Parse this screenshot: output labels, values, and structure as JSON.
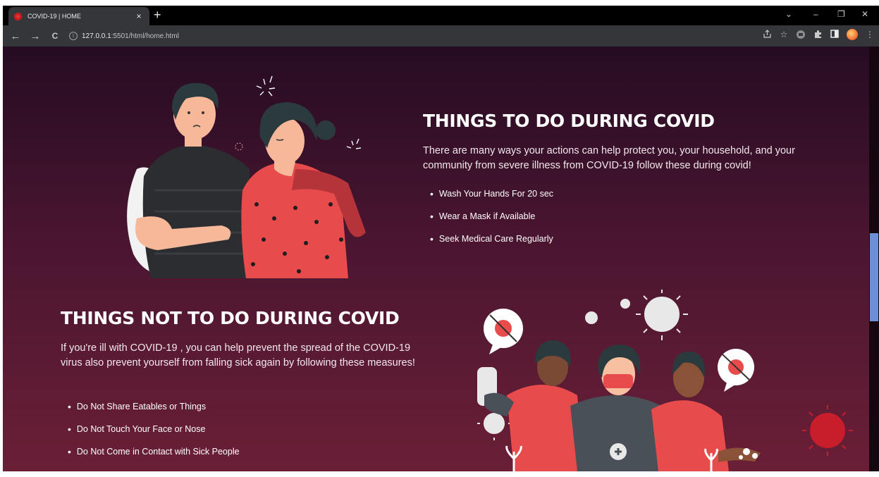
{
  "browser": {
    "tab_title": "COVID-19 | HOME",
    "tab_close": "×",
    "new_tab": "+",
    "url_host": "127.0.0.1",
    "url_rest": ":5501/html/home.html",
    "window_controls": [
      "⌄",
      "–",
      "❐",
      "✕"
    ],
    "nav": [
      "←",
      "→",
      "C"
    ],
    "toolbar_icons": [
      "share-icon",
      "star-icon",
      "extension-box-icon",
      "puzzle-icon",
      "sidebar-icon",
      "profile-icon",
      "menu-icon"
    ]
  },
  "section_do": {
    "title": "THINGS TO DO DURING COVID",
    "desc": "There are many ways your actions can help protect you, your household, and your community from severe illness from COVID-19 follow these during covid!",
    "items": [
      "Wash Your Hands For 20 sec",
      "Wear a Mask if Available",
      "Seek Medical Care Regularly"
    ]
  },
  "section_dont": {
    "title": "THINGS NOT TO DO DURING COVID",
    "desc": "If you're ill with COVID-19 , you can help prevent the spread of the COVID-19 virus also prevent yourself from falling sick again by following these measures!",
    "items": [
      "Do Not Share Eatables or Things",
      "Do Not Touch Your Face or Nose",
      "Do Not Come in Contact with Sick People"
    ]
  },
  "colors": {
    "bg_top": "#250c22",
    "bg_bottom": "#6a1f36",
    "accent_red": "#f0454f",
    "scroll_thumb": "#6c8fd6"
  }
}
